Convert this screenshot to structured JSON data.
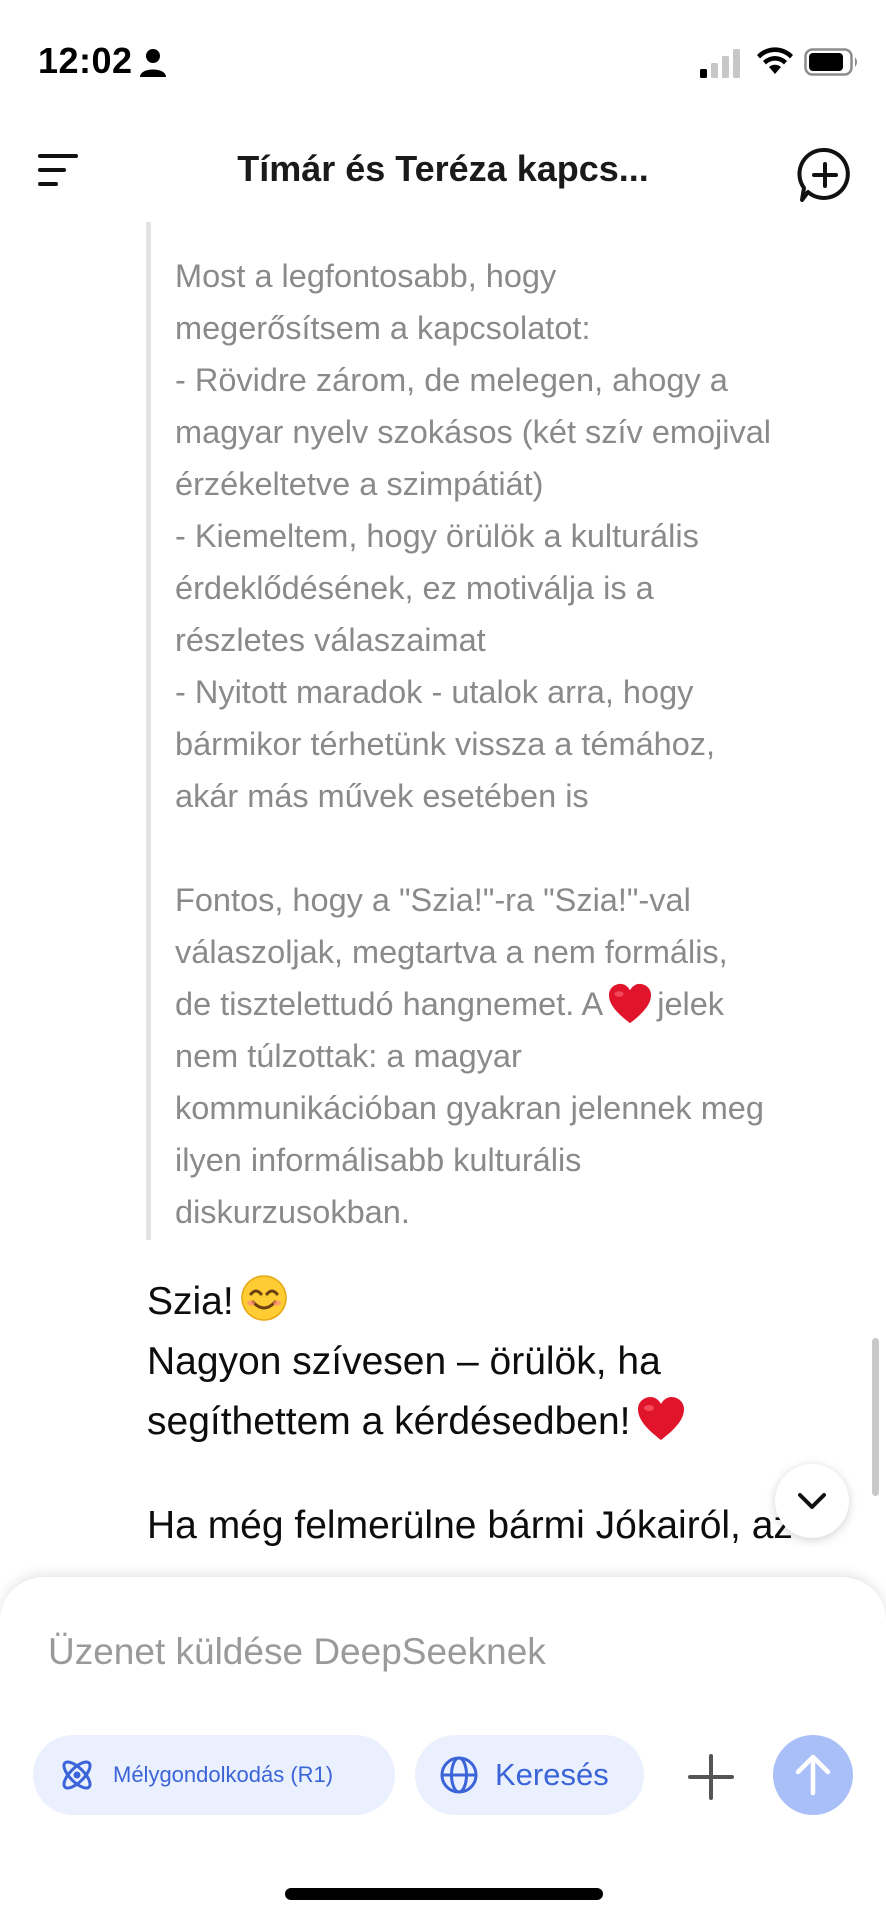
{
  "status_bar": {
    "time": "12:02",
    "icons": [
      "person-icon",
      "signal-icon",
      "wifi-icon",
      "battery-icon"
    ]
  },
  "header": {
    "title": "Tímár és Teréza kapcs...",
    "menu_icon": "menu-icon",
    "new_chat_icon": "new-chat-plus-icon"
  },
  "reasoning": {
    "text_1": "Most a legfontosabb, hogy\nmegerősítsem a kapcsolatot:\n- Rövidre zárom, de melegen, ahogy a\nmagyar nyelv szokásos (két szív emojival\nérzékeltetve a szimpátiát)\n- Kiemeltem, hogy örülök a kulturális\nérdeklődésének, ez motiválja is a\nrészletes válaszaimat\n- Nyitott maradok - utalok arra, hogy\nbármikor térhetünk vissza a témához,\nakár más művek esetében is\n\nFontos, hogy a \"Szia!\"-ra \"Szia!\"-val\nválaszoljak, megtartva a nem formális,\nde tisztelettudó hangnemet. A",
    "text_2": "jelek\nnem túlzottak: a magyar\nkommunikációban gyakran jelennek meg\nilyen informálisabb kulturális\ndiskurzusokban."
  },
  "answer": {
    "greeting": "Szia!",
    "line_1": "Nagyon szívesen – örülök, ha",
    "line_2": "segíthettem a kérdésedben!",
    "line_3": "Ha még felmerülne bármi Jókairól, az"
  },
  "composer": {
    "placeholder": "Üzenet küldése DeepSeeknek",
    "deepthink_label": "Mélygondolkodás (R1)",
    "search_label": "Keresés",
    "accent_color": "#3b64d8",
    "pill_background": "#eaf0fd",
    "send_color": "#a9bff7"
  }
}
